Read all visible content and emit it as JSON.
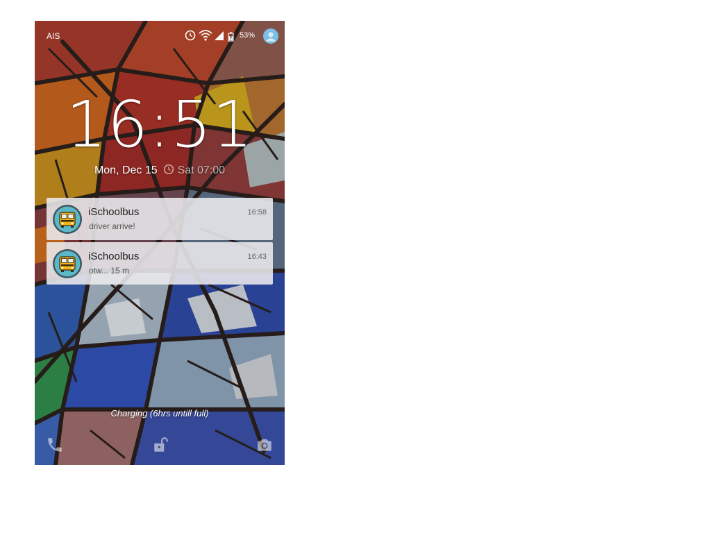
{
  "status_bar": {
    "carrier": "AIS",
    "battery_percent": "53%",
    "icons": [
      "alarm-icon",
      "wifi-icon",
      "cell-signal-icon",
      "battery-charging-icon",
      "user-avatar-icon"
    ]
  },
  "lockscreen": {
    "time": "16:51",
    "date": "Mon, Dec 15",
    "next_alarm": "Sat 07:00",
    "charging_text": "Charging (6hrs untill full)"
  },
  "notifications": [
    {
      "app": "iSchoolbus",
      "text": "driver arrive!",
      "time": "16:58",
      "icon": "school-bus-icon"
    },
    {
      "app": "iSchoolbus",
      "text": "otw... 15 m",
      "time": "16:43",
      "icon": "school-bus-icon"
    }
  ],
  "bottom_actions": {
    "icons": [
      "phone-icon",
      "unlock-icon",
      "camera-icon"
    ]
  },
  "colors": {
    "notification_bg": "#ECECEE",
    "bus_yellow": "#F4B41A",
    "icon_circle": "#5BB8C8"
  }
}
